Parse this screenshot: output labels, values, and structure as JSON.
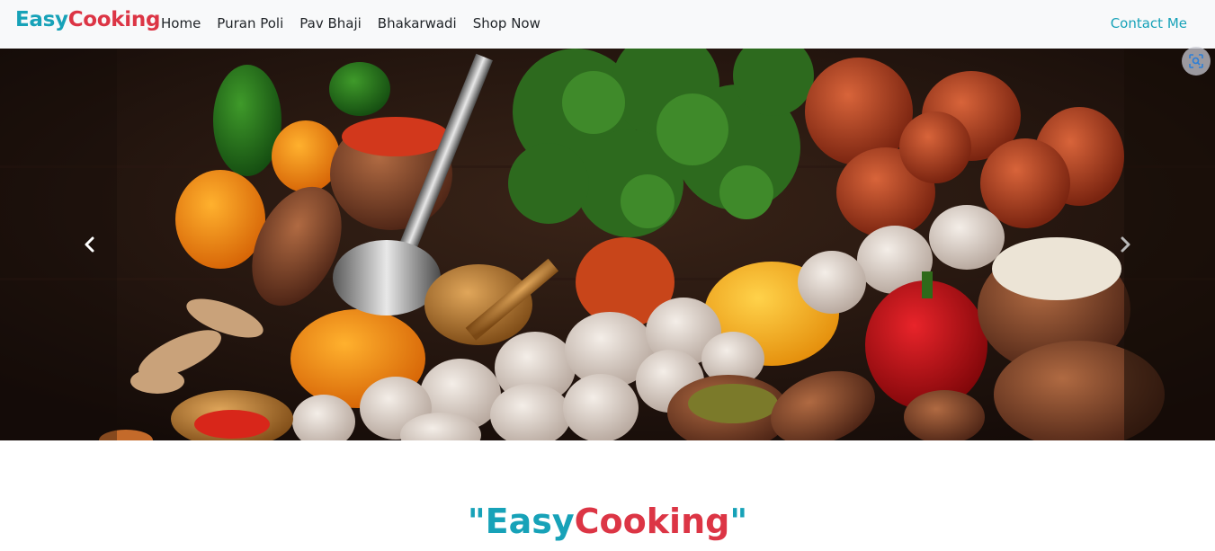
{
  "navbar": {
    "brand_easy": "Easy",
    "brand_cooking": "Cooking",
    "links": [
      "Home",
      "Puran Poli",
      "Pav Bhaji",
      "Bhakarwadi",
      "Shop Now"
    ],
    "contact": "Contact Me"
  },
  "carousel": {
    "image_icon": "vegetables-spices-photo",
    "prev_icon": "chevron-left-icon",
    "next_icon": "chevron-right-icon",
    "lens_icon": "visual-search-icon"
  },
  "hero": {
    "quote_open": "\"",
    "easy": "Easy",
    "cooking": "Cooking",
    "quote_close": "\""
  },
  "colors": {
    "easy": "#17a2b8",
    "cooking": "#dc3545",
    "navbar_bg": "#f8f9fa"
  }
}
